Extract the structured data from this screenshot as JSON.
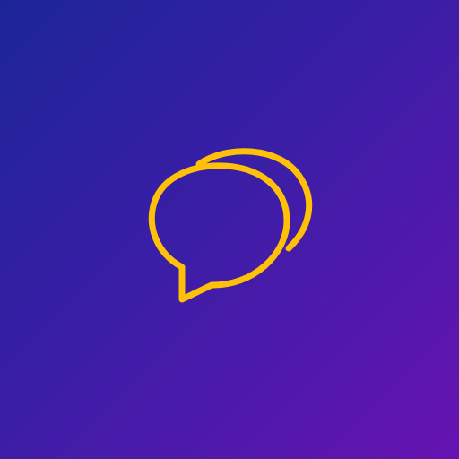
{
  "app": {
    "icon": "chat-bubbles-icon"
  },
  "colors": {
    "background_start": "#1c2598",
    "background_mid": "#3a1ea6",
    "background_end": "#6613b0",
    "icon_stroke": "#FFC107"
  }
}
